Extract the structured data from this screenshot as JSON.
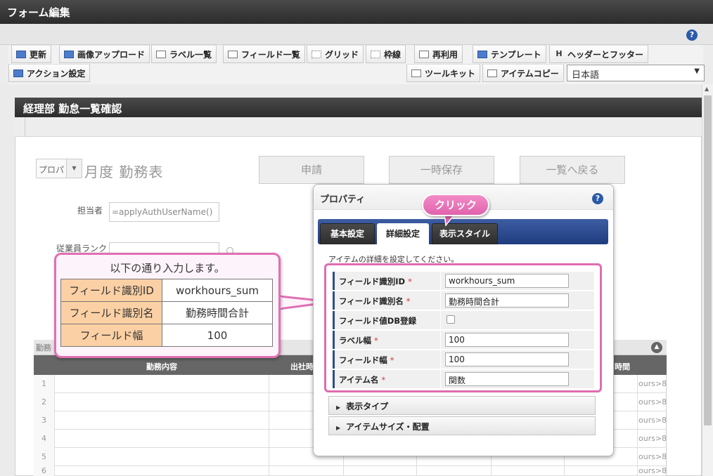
{
  "window": {
    "title": "フォーム編集"
  },
  "toolbar": {
    "items": [
      {
        "label": "更新",
        "icon": "refresh-icon"
      },
      {
        "label": "画像アップロード",
        "icon": "image-upload-icon"
      },
      {
        "label": "ラベル一覧",
        "icon": "label-list-icon"
      },
      {
        "label": "フィールド一覧",
        "icon": "field-list-icon"
      },
      {
        "label": "グリッド",
        "icon": "grid-icon"
      },
      {
        "label": "枠線",
        "icon": "border-icon"
      },
      {
        "label": "再利用",
        "icon": "reuse-icon"
      },
      {
        "label": "テンプレート",
        "icon": "template-icon"
      },
      {
        "label": "ヘッダーとフッター",
        "icon": "header-footer-icon"
      },
      {
        "label": "アクション設定",
        "icon": "action-icon"
      },
      {
        "label": "ツールキット",
        "icon": "toolkit-icon"
      },
      {
        "label": "アイテムコピー",
        "icon": "item-copy-icon"
      }
    ],
    "language": "日本語"
  },
  "form": {
    "header": "経理部 勤怠一覧確認",
    "prefix_select": "プロパ",
    "title": "月度 勤務表",
    "buttons": [
      "申請",
      "一時保存",
      "一覧へ戻る"
    ],
    "assignee_label": "担当者",
    "assignee_value": "=applyAuthUserName()",
    "rank_label": "従業員ランク",
    "table_caption": "勤務",
    "table_headers": [
      "勤務内容",
      "出社時",
      "時間"
    ],
    "row_numbers": [
      "1",
      "2",
      "3",
      "4",
      "5",
      "6"
    ],
    "row_formulas": [
      "ours>8,",
      "ours>8,",
      "ours>8,",
      "ours>8,",
      "ours>8,",
      "ours>8,"
    ]
  },
  "callout": {
    "text": "以下の通り入力します。",
    "rows": [
      {
        "key": "フィールド識別ID",
        "value": "workhours_sum"
      },
      {
        "key": "フィールド識別名",
        "value": "勤務時間合計"
      },
      {
        "key": "フィールド幅",
        "value": "100"
      }
    ]
  },
  "dialog": {
    "title": "プロパティ",
    "tabs": [
      "基本設定",
      "詳細設定",
      "表示スタイル"
    ],
    "active_tab": "詳細設定",
    "click_hint": "クリック",
    "description": "アイテムの詳細を設定してください。",
    "rows": [
      {
        "label": "フィールド識別ID",
        "required": "*",
        "value": "workhours_sum"
      },
      {
        "label": "フィールド識別名",
        "required": "*",
        "value": "勤務時間合計"
      },
      {
        "label": "フィールド値DB登録",
        "required": "",
        "checked": false
      },
      {
        "label": "ラベル幅",
        "required": "*",
        "value": "100"
      },
      {
        "label": "フィールド幅",
        "required": "*",
        "value": "100"
      },
      {
        "label": "アイテム名",
        "required": "*",
        "value": "関数"
      }
    ],
    "sections": [
      "表示タイプ",
      "アイテムサイズ・配置"
    ]
  },
  "colors": {
    "highlight": "#e06cb0",
    "tab_bar": "#2e4c93",
    "callout_key_bg": "#fbd0a4"
  }
}
